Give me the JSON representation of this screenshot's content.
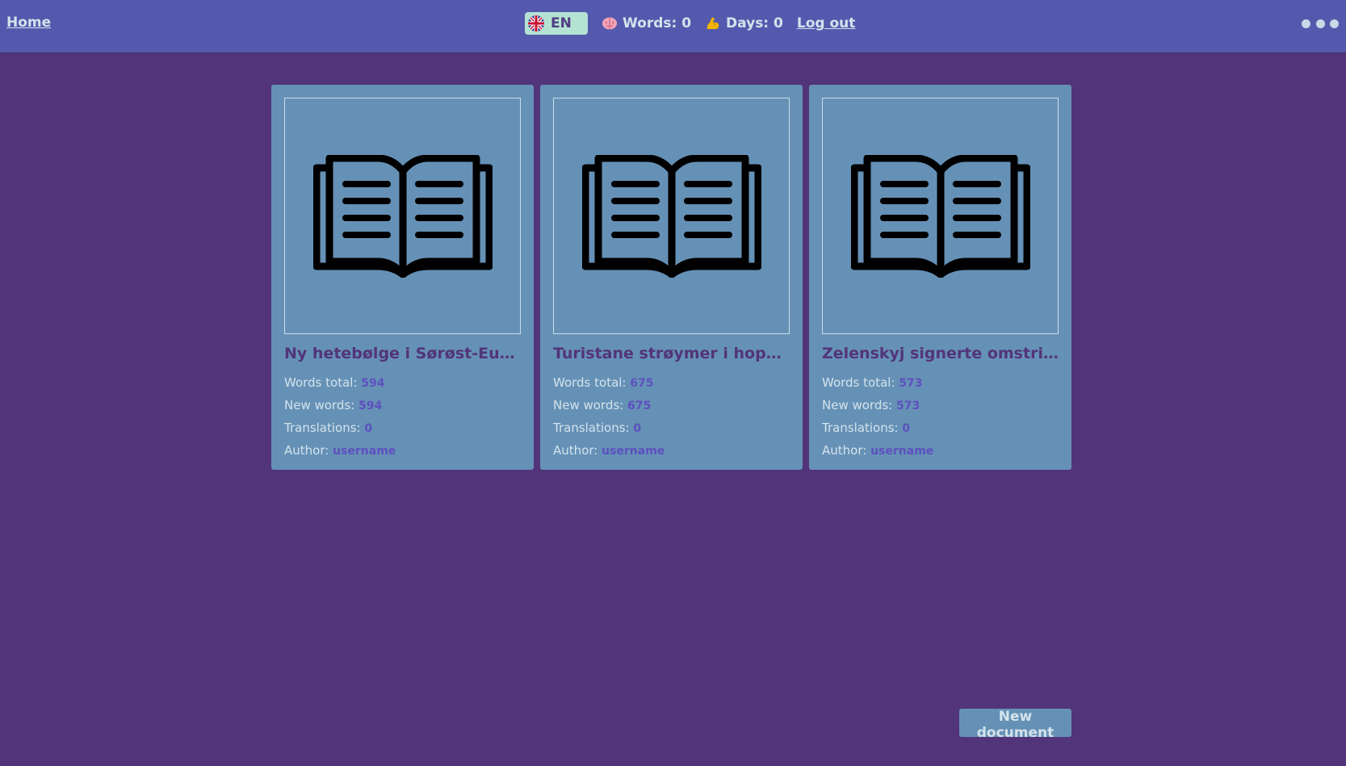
{
  "nav": {
    "home": "Home",
    "language": "EN",
    "words_label": "Words: 0",
    "days_label": "Days: 0",
    "logout": "Log out"
  },
  "labels": {
    "words_total": "Words total:",
    "new_words": "New words:",
    "translations": "Translations:",
    "author": "Author:"
  },
  "documents": [
    {
      "title": "Ny hetebølge i Sørøst-Europa ...",
      "words_total": "594",
      "new_words": "594",
      "translations": "0",
      "author": "username"
    },
    {
      "title": "Turistane strøymer i hopetal ti...",
      "words_total": "675",
      "new_words": "675",
      "translations": "0",
      "author": "username"
    },
    {
      "title": "Zelenskyj signerte omstridt lo...",
      "words_total": "573",
      "new_words": "573",
      "translations": "0",
      "author": "username"
    }
  ],
  "actions": {
    "new_document": "New document"
  },
  "icons": {
    "flag": "uk-flag-icon",
    "words": "brain-icon",
    "days": "flexed-biceps-icon",
    "more": "more-dots-icon",
    "cover": "open-book-icon"
  },
  "colors": {
    "background": "#52347a",
    "topbar": "#5559ad",
    "card": "#6691b6",
    "language_button": "#b5e3d3",
    "value_accent": "#5d50bf"
  }
}
